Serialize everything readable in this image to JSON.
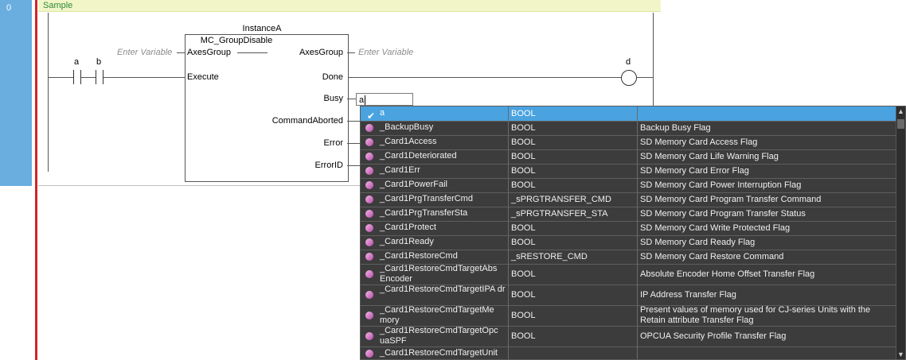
{
  "rung": {
    "number": "0",
    "comment": "Sample"
  },
  "ladder": {
    "contact_a": "a",
    "contact_b": "b",
    "coil_d": "d"
  },
  "function_block": {
    "instance": "InstanceA",
    "name": "MC_GroupDisable",
    "in_pins": [
      "AxesGroup",
      "Execute"
    ],
    "inout_out_label": "AxesGroup",
    "out_pins": [
      "Done",
      "Busy",
      "CommandAborted",
      "Error",
      "ErrorID"
    ],
    "enter_variable_left": "Enter Variable",
    "enter_variable_right": "Enter Variable",
    "busy_input_value": "a"
  },
  "autocomplete": {
    "rows": [
      {
        "name": "a",
        "type": "BOOL",
        "desc": "",
        "selected": true
      },
      {
        "name": "_BackupBusy",
        "type": "BOOL",
        "desc": "Backup Busy Flag"
      },
      {
        "name": "_Card1Access",
        "type": "BOOL",
        "desc": "SD Memory Card Access Flag"
      },
      {
        "name": "_Card1Deteriorated",
        "type": "BOOL",
        "desc": "SD Memory Card Life Warning Flag"
      },
      {
        "name": "_Card1Err",
        "type": "BOOL",
        "desc": "SD Memory Card Error Flag"
      },
      {
        "name": "_Card1PowerFail",
        "type": "BOOL",
        "desc": "SD Memory Card Power Interruption Flag"
      },
      {
        "name": "_Card1PrgTransferCmd",
        "type": "_sPRGTRANSFER_CMD",
        "desc": "SD Memory Card Program Transfer Command"
      },
      {
        "name": "_Card1PrgTransferSta",
        "type": "_sPRGTRANSFER_STA",
        "desc": "SD Memory Card Program Transfer Status"
      },
      {
        "name": "_Card1Protect",
        "type": "BOOL",
        "desc": "SD Memory Card Write Protected Flag"
      },
      {
        "name": "_Card1Ready",
        "type": "BOOL",
        "desc": "SD Memory Card Ready Flag"
      },
      {
        "name": "_Card1RestoreCmd",
        "type": "_sRESTORE_CMD",
        "desc": "SD Memory Card Restore Command"
      },
      {
        "name": "_Card1RestoreCmdTargetAbs Encoder",
        "type": "BOOL",
        "desc": "Absolute Encoder Home Offset Transfer Flag"
      },
      {
        "name": "_Card1RestoreCmdTargetIPA dr",
        "type": "BOOL",
        "desc": "IP Address Transfer Flag"
      },
      {
        "name": "_Card1RestoreCmdTargetMe mory",
        "type": "BOOL",
        "desc": "Present values of memory used for CJ-series Units with the Retain attribute Transfer Flag"
      },
      {
        "name": "_Card1RestoreCmdTargetOpc uaSPF",
        "type": "BOOL",
        "desc": "OPCUA Security Profile Transfer Flag"
      },
      {
        "name": "_Card1RestoreCmdTargetUnit",
        "type": "",
        "desc": ""
      }
    ]
  },
  "colors": {
    "rung_bar": "#6aaee0",
    "power_rail": "#d4232b",
    "comment_bg": "#f1f5c8",
    "popup_bg": "#3c3c3c",
    "selected_row": "#4aa3df"
  }
}
